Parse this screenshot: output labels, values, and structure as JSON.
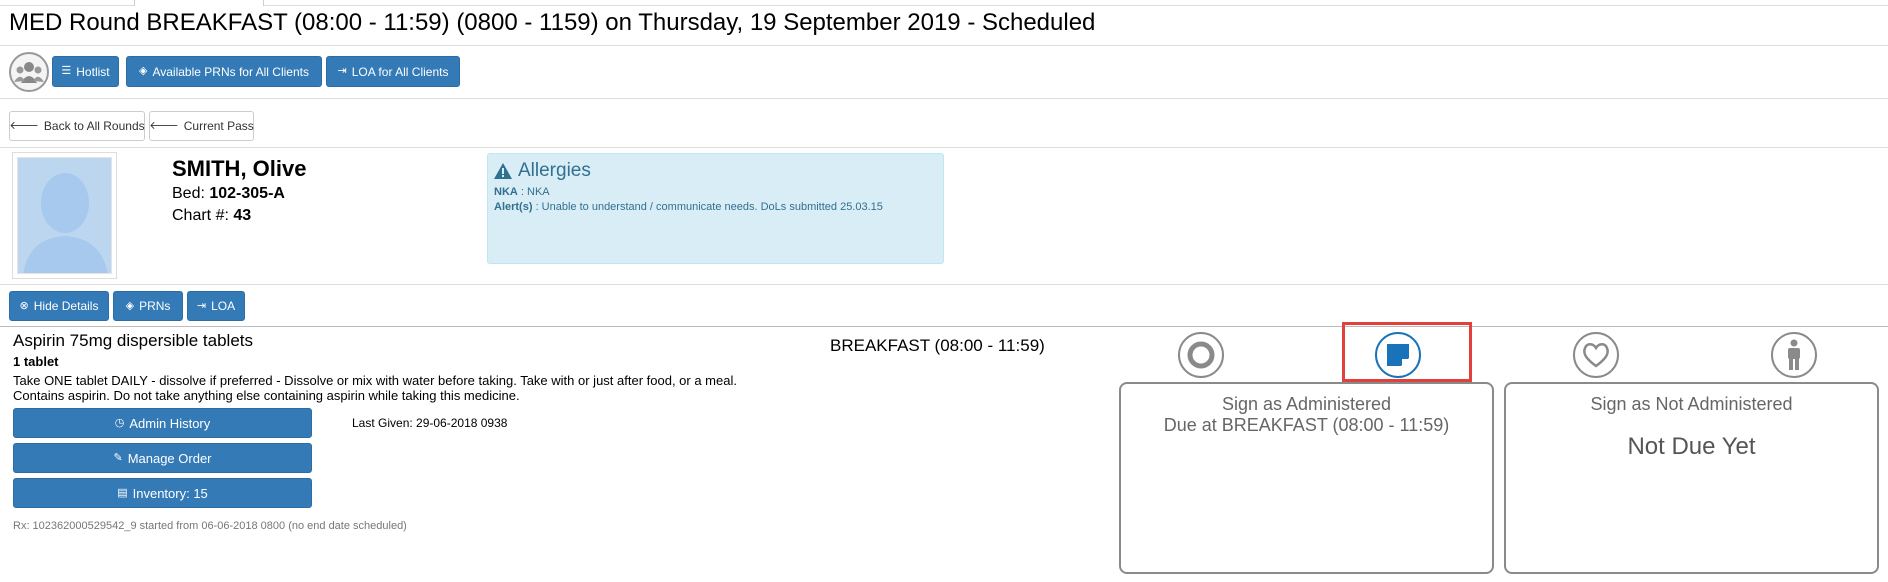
{
  "page_title": "MED Round BREAKFAST (08:00 - 11:59) (0800 - 1159) on Thursday, 19 September 2019 - Scheduled",
  "toolbar": {
    "hotlist": "Hotlist",
    "available_prns": "Available PRNs for All Clients",
    "loa_all": "LOA for All Clients"
  },
  "nav": {
    "back": "Back to All Rounds",
    "current_pass": "Current Pass"
  },
  "patient": {
    "name": "SMITH, Olive",
    "bed_label": "Bed: ",
    "bed": "102-305-A",
    "chart_label": "Chart #: ",
    "chart": "43"
  },
  "allergies": {
    "title": "Allergies",
    "nka_label": "NKA",
    "nka_value": " : NKA",
    "alert_label": "Alert(s)",
    "alert_value": " : Unable to understand / communicate needs. DoLs submitted 25.03.15"
  },
  "detail_buttons": {
    "hide_details": "Hide Details",
    "prns": "PRNs",
    "loa": "LOA"
  },
  "medication": {
    "name": "Aspirin 75mg dispersible tablets",
    "dose": "1 tablet",
    "instructions": "Take ONE tablet DAILY - dissolve if preferred - Dissolve or mix with water before taking. Take with or just after food, or a meal. Contains aspirin. Do not take anything else containing aspirin while taking this medicine.",
    "admin_history": "Admin History",
    "manage_order": "Manage Order",
    "inventory": "Inventory: 15",
    "last_given": "Last Given: 29-06-2018 0938",
    "rx": "Rx: 102362000529542_9 started from 06-06-2018 0800 (no end date scheduled)"
  },
  "round_label": "BREAKFAST (08:00 - 11:59)",
  "panels": {
    "administered_title": "Sign as Administered",
    "administered_due": "Due at BREAKFAST (08:00 - 11:59)",
    "not_administered_title": "Sign as Not Administered",
    "not_due": "Not Due Yet"
  },
  "icons": {
    "group": "group-icon",
    "circle": "circle-icon",
    "note": "note-icon",
    "heart": "heart-icon",
    "person": "person-icon"
  },
  "colors": {
    "primary": "#337ab7",
    "active_icon": "#1a73b8",
    "highlight": "#e2403c",
    "info_bg": "#d9edf7",
    "info_text": "#31708f"
  }
}
